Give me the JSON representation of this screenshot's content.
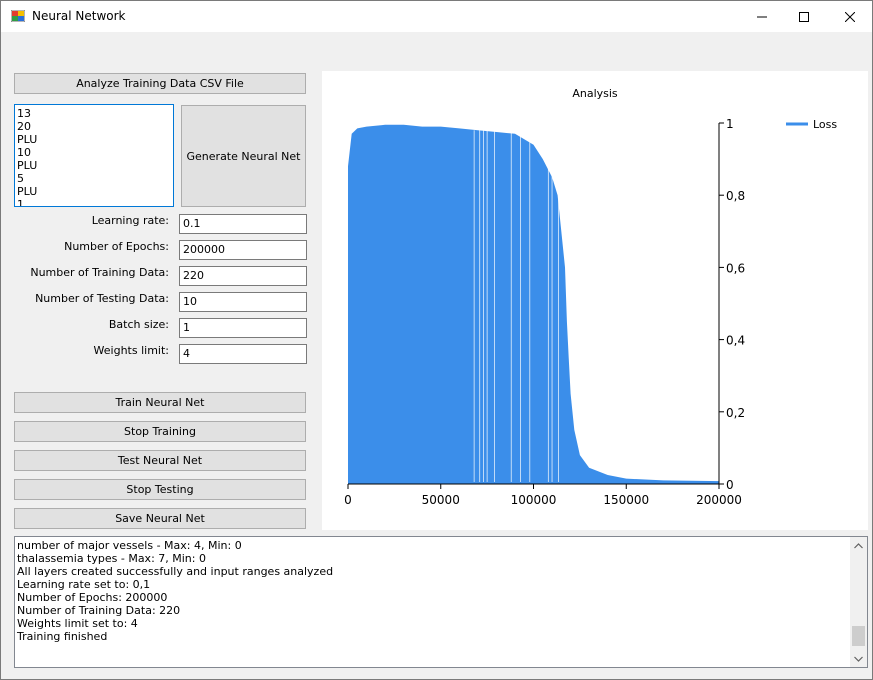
{
  "window": {
    "title": "Neural Network"
  },
  "buttons": {
    "analyze": "Analyze Training Data CSV File",
    "generate": "Generate Neural Net",
    "train": "Train Neural Net",
    "stop_training": "Stop Training",
    "test": "Test Neural Net",
    "stop_testing": "Stop Testing",
    "save": "Save Neural Net"
  },
  "listbox": {
    "items": [
      "13",
      "20",
      "PLU",
      "10",
      "PLU",
      "5",
      "PLU",
      "1"
    ]
  },
  "fields": [
    {
      "label": "Learning rate:",
      "value": "0.1"
    },
    {
      "label": "Number of Epochs:",
      "value": "200000"
    },
    {
      "label": "Number of Training Data:",
      "value": "220"
    },
    {
      "label": "Number of Testing Data:",
      "value": "10"
    },
    {
      "label": "Batch size:",
      "value": "1"
    },
    {
      "label": "Weights limit:",
      "value": "4"
    }
  ],
  "log": {
    "lines": [
      "number of major vessels - Max: 4, Min: 0",
      "thalassemia types - Max: 7, Min: 0",
      "All layers created successfully and input ranges analyzed",
      "Learning rate set to: 0,1",
      "Number of Epochs: 200000",
      "Number of Training Data: 220",
      "Weights limit set to: 4",
      "Training finished"
    ],
    "scroll_position": 0.95
  },
  "colors": {
    "series": "#3b8eea",
    "accent": "#0078d7"
  },
  "chart_data": {
    "type": "area",
    "title": "Analysis",
    "legend": {
      "position": "top-right",
      "entries": [
        "Loss"
      ]
    },
    "xlim": [
      0,
      200000
    ],
    "ylim": [
      0,
      1
    ],
    "x_ticks": [
      "0",
      "50000",
      "100000",
      "150000",
      "200000"
    ],
    "y_ticks": [
      "0",
      "0,2",
      "0,4",
      "0,6",
      "0,8",
      "1"
    ],
    "y_axis_side": "right",
    "grid": false,
    "series": [
      {
        "name": "Loss",
        "x": [
          0,
          2000,
          5000,
          10000,
          20000,
          30000,
          40000,
          50000,
          60000,
          70000,
          80000,
          90000,
          100000,
          105000,
          110000,
          113000,
          115000,
          117000,
          118000,
          119000,
          120000,
          122000,
          125000,
          130000,
          140000,
          150000,
          170000,
          200000
        ],
        "y": [
          0.88,
          0.97,
          0.985,
          0.99,
          0.995,
          0.995,
          0.99,
          0.99,
          0.985,
          0.98,
          0.975,
          0.97,
          0.94,
          0.9,
          0.85,
          0.8,
          0.7,
          0.6,
          0.45,
          0.35,
          0.25,
          0.15,
          0.08,
          0.045,
          0.025,
          0.015,
          0.01,
          0.008
        ]
      }
    ]
  }
}
